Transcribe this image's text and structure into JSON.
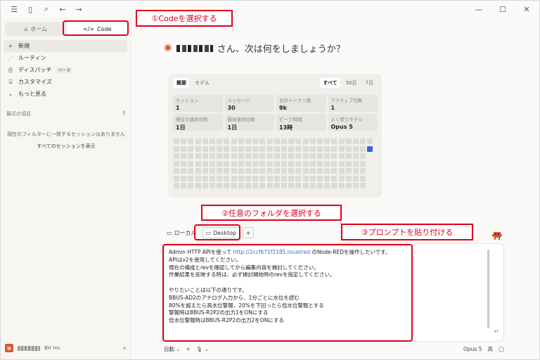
{
  "sidebar": {
    "tabs": [
      {
        "icon": "home-icon",
        "label": "ホーム"
      },
      {
        "icon": "code-icon",
        "label": "Code"
      }
    ],
    "nav": [
      {
        "icon": "plus-icon",
        "label": "新規"
      },
      {
        "icon": "routine-icon",
        "label": "ルーティン"
      },
      {
        "icon": "dispatch-icon",
        "label": "ディスパッチ",
        "badge": "ベータ"
      },
      {
        "icon": "customize-icon",
        "label": "カスタマイズ"
      },
      {
        "icon": "chevron-down-icon",
        "label": "もっと見る"
      }
    ],
    "recent_heading": "最近の項目",
    "empty_message": "現在のフィルターに一致するセッションはありません",
    "show_all": "すべてのセッションを表示",
    "user": {
      "org": "BH Inc."
    }
  },
  "main": {
    "greeting_suffix": "さん、次は何をしましょうか？",
    "stats": {
      "tabs": [
        "概要",
        "モデル"
      ],
      "ranges": [
        "すべて",
        "30日",
        "7日"
      ],
      "cards": [
        {
          "label": "セッション",
          "value": "1"
        },
        {
          "label": "メッセージ",
          "value": "30"
        },
        {
          "label": "合計トークン数",
          "value": "9k"
        },
        {
          "label": "アクティブ日数",
          "value": "1"
        },
        {
          "label": "現在の連続日数",
          "value": "1日"
        },
        {
          "label": "最長連続日数",
          "value": "1日"
        },
        {
          "label": "ピーク時間",
          "value": "13時"
        },
        {
          "label": "よく使うモデル",
          "value": "Opus 5"
        }
      ]
    },
    "source": {
      "local": "ローカル",
      "folder": "Desktop"
    },
    "prompt": {
      "l1a": "Admin HTTP APIを使って ",
      "l1link": "http://2ccf671f2185.local/red",
      "l1b": " のNode-REDを操作したいです。",
      "body": "\nAPIはv2を使用してください。\n現在の構成とrevを確認してから編集内容を検討してください。\n作業結果を反映する時は、必ず検討開始時のrevを指定してください。\n\nやりたいことは以下の通りです。\nBBUS-AD2のアナログ入力から、1分ごとに水位を読む\n80%を超えたら高水位警報、20%を下回ったら低水位警報とする\n警報時はBBUS-R2P2の出力1をONにする\n低水位警報時はBBUS-R2P2の出力2をONにする"
    },
    "bottom": {
      "mode": "自動",
      "model": "Opus 5",
      "effort": "高"
    }
  },
  "annotations": {
    "a1": "①Codeを選択する",
    "a2": "②任意のフォルダを選択する",
    "a3": "③プロンプトを貼り付ける",
    "color": "#e0001b"
  }
}
